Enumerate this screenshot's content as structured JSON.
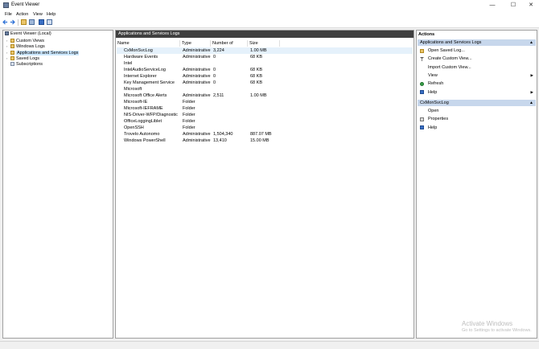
{
  "window": {
    "title": "Event Viewer",
    "minimize": "—",
    "maximize": "☐",
    "close": "✕"
  },
  "menu": [
    "File",
    "Action",
    "View",
    "Help"
  ],
  "tree": [
    {
      "label": "Event Viewer (Local)",
      "arrow": ""
    },
    {
      "label": "Custom Views",
      "arrow": "›"
    },
    {
      "label": "Windows Logs",
      "arrow": "›"
    },
    {
      "label": "Applications and Services Logs",
      "arrow": "›"
    },
    {
      "label": "Saved Logs",
      "arrow": "›"
    },
    {
      "label": "Subscriptions",
      "arrow": ""
    }
  ],
  "center": {
    "title": "Applications and Services Logs",
    "columns": [
      "Name",
      "Type",
      "Number of Events",
      "Size"
    ],
    "rows": [
      {
        "name": "CxMonSvcLog",
        "type": "Administrative",
        "events": "3,224",
        "size": "1.00 MB"
      },
      {
        "name": "Hardware Events",
        "type": "Administrative",
        "events": "0",
        "size": "68 KB"
      },
      {
        "name": "Intel",
        "type": "",
        "events": "",
        "size": ""
      },
      {
        "name": "IntelAudioServiceLog",
        "type": "Administrative",
        "events": "0",
        "size": "68 KB"
      },
      {
        "name": "Internet Explorer",
        "type": "Administrative",
        "events": "0",
        "size": "68 KB"
      },
      {
        "name": "Key Management Service",
        "type": "Administrative",
        "events": "0",
        "size": "68 KB"
      },
      {
        "name": "Microsoft",
        "type": "",
        "events": "",
        "size": ""
      },
      {
        "name": "Microsoft Office Alerts",
        "type": "Administrative",
        "events": "2,511",
        "size": "1.00 MB"
      },
      {
        "name": "Microsoft-IE",
        "type": "Folder",
        "events": "",
        "size": ""
      },
      {
        "name": "Microsoft-IEFRAME",
        "type": "Folder",
        "events": "",
        "size": ""
      },
      {
        "name": "NIS-Driver-WFP/Diagnostic",
        "type": "Folder",
        "events": "",
        "size": ""
      },
      {
        "name": "OfficeLoggingLiblet",
        "type": "Folder",
        "events": "",
        "size": ""
      },
      {
        "name": "OpenSSH",
        "type": "Folder",
        "events": "",
        "size": ""
      },
      {
        "name": "Trovelo Autonomo",
        "type": "Administrative",
        "events": "1,504,340",
        "size": "887.07 MB"
      },
      {
        "name": "Windows PowerShell",
        "type": "Administrative",
        "events": "13,410",
        "size": "15.00 MB"
      }
    ]
  },
  "actions": {
    "title": "Actions",
    "section1": {
      "title": "Applications and Services Logs",
      "items": [
        {
          "label": "Open Saved Log...",
          "icon": "folder-icon",
          "sub": ""
        },
        {
          "label": "Create Custom View...",
          "icon": "filter-icon",
          "sub": ""
        },
        {
          "label": "Import Custom View...",
          "icon": "",
          "sub": ""
        },
        {
          "label": "View",
          "icon": "",
          "sub": "▶"
        },
        {
          "label": "Refresh",
          "icon": "refresh-icon",
          "sub": ""
        },
        {
          "label": "Help",
          "icon": "help-icon",
          "sub": "▶"
        }
      ]
    },
    "section2": {
      "title": "CxMonSvcLog",
      "items": [
        {
          "label": "Open",
          "icon": "",
          "sub": ""
        },
        {
          "label": "Properties",
          "icon": "properties-icon",
          "sub": ""
        },
        {
          "label": "Help",
          "icon": "help-icon",
          "sub": ""
        }
      ]
    },
    "collapse_caret": "▲"
  },
  "watermark": {
    "line1": "Activate Windows",
    "line2": "Go to Settings to activate Windows."
  }
}
